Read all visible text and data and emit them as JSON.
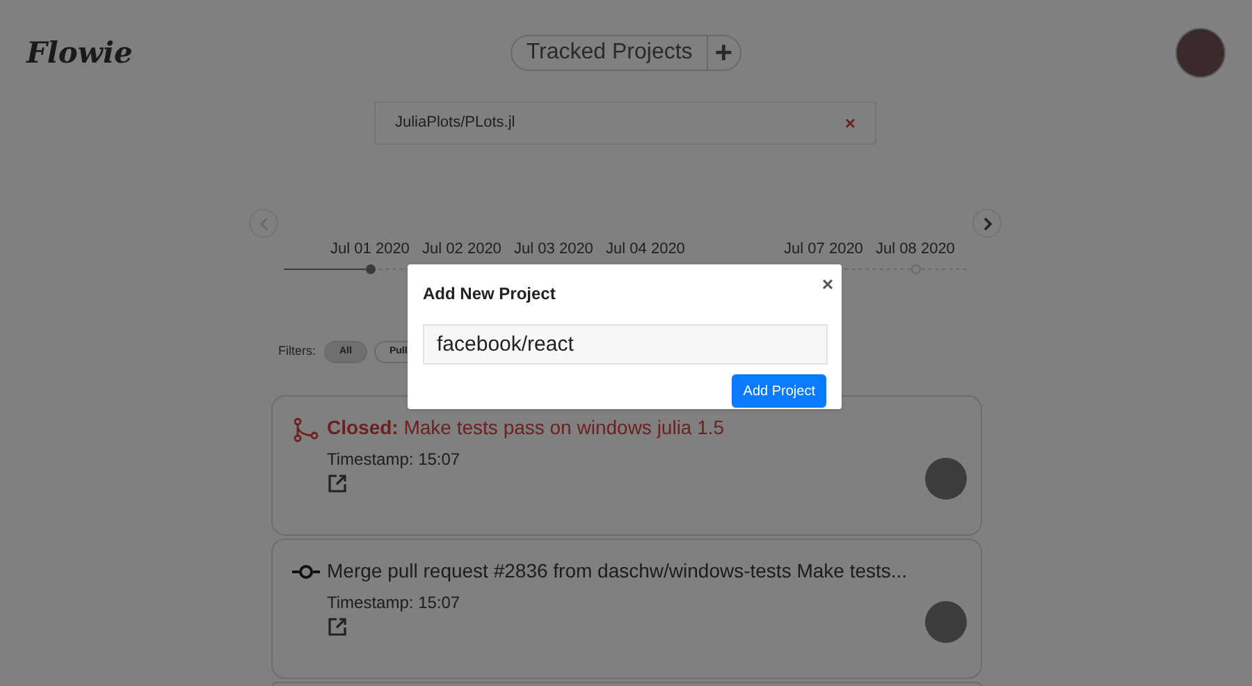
{
  "header": {
    "logo": "Flowie",
    "tracked_button": "Tracked Projects",
    "add_button": "+"
  },
  "projects": [
    {
      "name": "JuliaPlots/PLots.jl",
      "remove": "×"
    }
  ],
  "timeline": {
    "left": [
      {
        "label": "Jul 01 2020",
        "selected": true
      },
      {
        "label": "Jul 02 2020"
      },
      {
        "label": "Jul 03 2020"
      },
      {
        "label": "Jul 04 2020"
      }
    ],
    "right": [
      {
        "label": "Jul 07 2020"
      },
      {
        "label": "Jul 08 2020",
        "selected": false
      }
    ]
  },
  "filters": {
    "label": "Filters:",
    "items": [
      {
        "label": "All",
        "selected": true
      },
      {
        "label": "Pull",
        "selected": false
      }
    ]
  },
  "events": [
    {
      "kind": "closed",
      "status": "Closed:",
      "title": "Make tests pass on windows julia 1.5",
      "timestamp": "Timestamp: 15:07"
    },
    {
      "kind": "commit",
      "title": "Merge pull request #2836 from daschw/windows-tests Make tests...",
      "timestamp": "Timestamp: 15:07"
    }
  ],
  "modal": {
    "title": "Add New Project",
    "close": "×",
    "input_value": "facebook/react",
    "submit": "Add Project"
  }
}
